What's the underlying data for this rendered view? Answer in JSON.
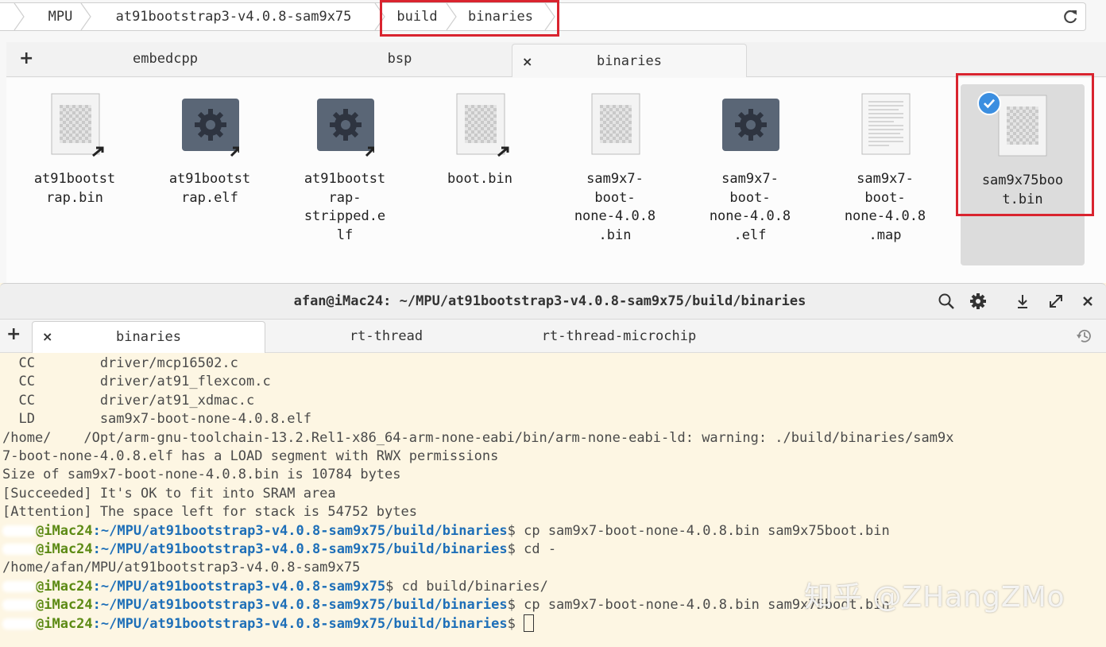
{
  "file_manager": {
    "breadcrumbs": [
      "MPU",
      "at91bootstrap3-v4.0.8-sam9x75",
      "build",
      "binaries"
    ],
    "tabs": [
      {
        "label": "embedcpp",
        "active": false
      },
      {
        "label": "bsp",
        "active": false
      },
      {
        "label": "binaries",
        "active": true
      }
    ],
    "add_tab_label": "+",
    "close_tab_label": "×",
    "files": [
      {
        "name": "at91bootst\nrap.bin",
        "icon": "binary-file-link-icon"
      },
      {
        "name": "at91bootst\nrap.elf",
        "icon": "executable-file-link-icon"
      },
      {
        "name": "at91bootst\nrap-\nstripped.e\nlf",
        "icon": "executable-file-link-icon"
      },
      {
        "name": "boot.bin",
        "icon": "binary-file-link-icon"
      },
      {
        "name": "sam9x7-\nboot-\nnone-4.0.8\n.bin",
        "icon": "binary-file-icon"
      },
      {
        "name": "sam9x7-\nboot-\nnone-4.0.8\n.elf",
        "icon": "executable-file-icon"
      },
      {
        "name": "sam9x7-\nboot-\nnone-4.0.8\n.map",
        "icon": "text-file-icon"
      },
      {
        "name": "sam9x75boo\nt.bin",
        "icon": "binary-file-icon",
        "selected": true
      }
    ]
  },
  "terminal": {
    "title": "afan@iMac24: ~/MPU/at91bootstrap3-v4.0.8-sam9x75/build/binaries",
    "tabs": [
      {
        "label": "binaries",
        "active": true
      },
      {
        "label": "rt-thread",
        "active": false
      },
      {
        "label": "rt-thread-microchip",
        "active": false
      }
    ],
    "add_tab_label": "+",
    "close_tab_label": "×",
    "output": [
      "  CC        driver/mcp16502.c",
      "  CC        driver/at91_flexcom.c",
      "  CC        driver/at91_xdmac.c",
      "  LD        sam9x7-boot-none-4.0.8.elf",
      "/home/    /Opt/arm-gnu-toolchain-13.2.Rel1-x86_64-arm-none-eabi/bin/arm-none-eabi-ld: warning: ./build/binaries/sam9x",
      "7-boot-none-4.0.8.elf has a LOAD segment with RWX permissions",
      "Size of sam9x7-boot-none-4.0.8.bin is 10784 bytes",
      "[Succeeded] It's OK to fit into SRAM area",
      "[Attention] The space left for stack is 54752 bytes"
    ],
    "prompts": [
      {
        "user": "@iMac24",
        "path": ":~/MPU/at91bootstrap3-v4.0.8-sam9x75/build/binaries",
        "cmd": "$ cp sam9x7-boot-none-4.0.8.bin sam9x75boot.bin"
      },
      {
        "user": "@iMac24",
        "path": ":~/MPU/at91bootstrap3-v4.0.8-sam9x75/build/binaries",
        "cmd": "$ cd -"
      },
      {
        "plain": "/home/afan/MPU/at91bootstrap3-v4.0.8-sam9x75"
      },
      {
        "user": "@iMac24",
        "path": ":~/MPU/at91bootstrap3-v4.0.8-sam9x75",
        "cmd": "$ cd build/binaries/"
      },
      {
        "user": "@iMac24",
        "path": ":~/MPU/at91bootstrap3-v4.0.8-sam9x75/build/binaries",
        "cmd": "$ cp sam9x7-boot-none-4.0.8.bin sam9x75boot.bin"
      },
      {
        "user": "@iMac24",
        "path": ":~/MPU/at91bootstrap3-v4.0.8-sam9x75/build/binaries",
        "cmd": "$ "
      }
    ]
  },
  "watermark": "知乎 @ZHangZMo",
  "colors": {
    "highlight": "#d9242f",
    "prompt_user": "#5c8a14",
    "prompt_path": "#1e6fb8",
    "terminal_bg": "#fdf6e3",
    "selection_check": "#3b8ee0"
  }
}
